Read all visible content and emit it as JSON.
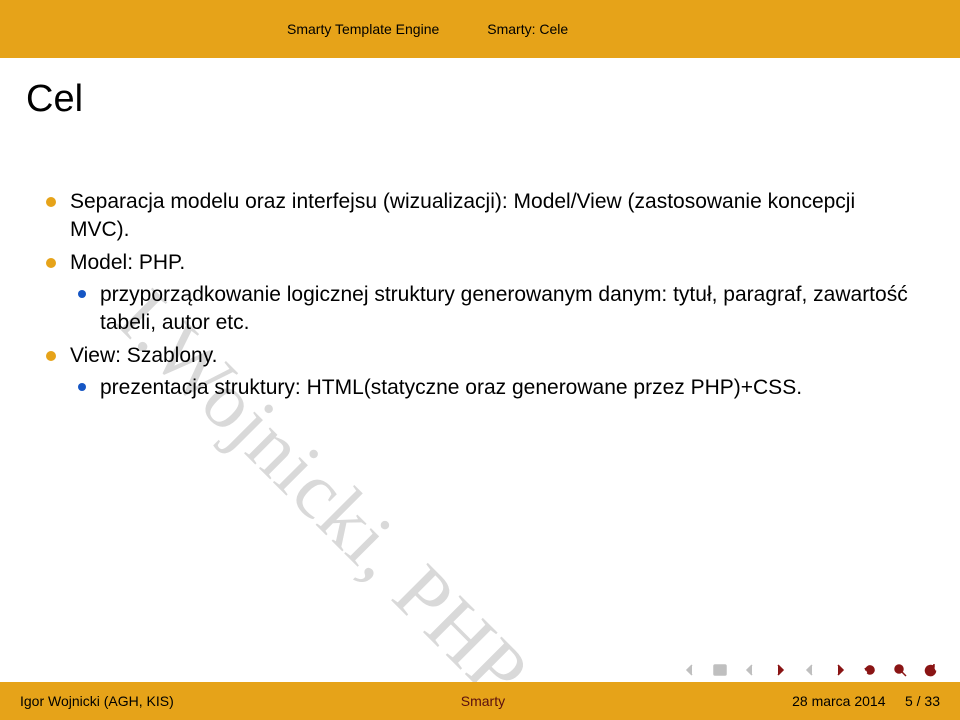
{
  "header": {
    "crumb1": "Smarty Template Engine",
    "crumb2": "Smarty: Cele"
  },
  "title": "Cel",
  "watermark": "I.Wojnicki, PHP",
  "bullets": {
    "b1": "Separacja modelu oraz interfejsu (wizualizacji): Model/View (zastosowanie koncepcji MVC).",
    "b2": "Model: PHP.",
    "b2_1": "przyporządkowanie logicznej struktury generowanym danym: tytuł, paragraf, zawartość tabeli, autor etc.",
    "b3": "View: Szablony.",
    "b3_1": "prezentacja struktury: HTML(statyczne oraz generowane przez PHP)+CSS."
  },
  "footer": {
    "author": "Igor Wojnicki (AGH, KIS)",
    "center": "Smarty",
    "date": "28 marca 2014",
    "page": "5 / 33"
  }
}
